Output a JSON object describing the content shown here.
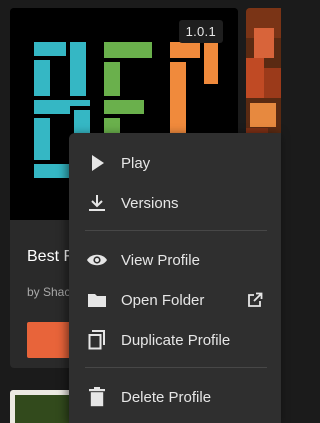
{
  "profile_card": {
    "version": "1.0.1",
    "title": "Best F",
    "author": "by Shac",
    "art_text": "BEC"
  },
  "context_menu": {
    "items": [
      {
        "label": "Play",
        "icon": "play-icon"
      },
      {
        "label": "Versions",
        "icon": "download-icon"
      },
      {
        "label": "View Profile",
        "icon": "eye-icon"
      },
      {
        "label": "Open Folder",
        "icon": "folder-icon",
        "trailing_icon": "external-link-icon"
      },
      {
        "label": "Duplicate Profile",
        "icon": "copy-icon"
      },
      {
        "label": "Delete Profile",
        "icon": "trash-icon"
      }
    ]
  },
  "colors": {
    "accent": "#e8643a",
    "menu_bg": "#2f2f2f",
    "card_bg": "#2a2a2a",
    "art_letter_1": "#35b7c4",
    "art_letter_2": "#6ab04c",
    "art_letter_3": "#f08a3c"
  }
}
